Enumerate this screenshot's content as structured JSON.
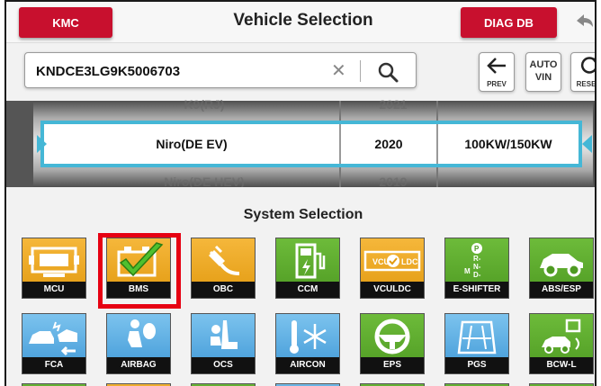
{
  "header": {
    "kmc_label": "KMC",
    "title": "Vehicle Selection",
    "diag_label": "DIAG DB"
  },
  "vin": {
    "value": "KNDCE3LG9K5006703",
    "clear_glyph": "✕"
  },
  "toolbar": {
    "prev_label": "PREV",
    "auto_vin_line1": "AUTO",
    "auto_vin_line2": "VIN",
    "reset_label": "RESET"
  },
  "drum": {
    "above": {
      "model": "K9(RJ)",
      "year": "2021"
    },
    "selected": {
      "model": "Niro(DE EV)",
      "year": "2020",
      "engine": "100KW/150KW"
    },
    "below": {
      "model": "Niro(DE HEV)",
      "year": "2019"
    }
  },
  "systems": {
    "title": "System Selection",
    "row1": [
      {
        "label": "MCU",
        "color": "orange",
        "icon": "mcu-icon"
      },
      {
        "label": "BMS",
        "color": "orange",
        "icon": "battery-check-icon",
        "selected": true
      },
      {
        "label": "OBC",
        "color": "orange",
        "icon": "charger-plug-icon"
      },
      {
        "label": "CCM",
        "color": "green",
        "icon": "charging-station-icon"
      },
      {
        "label": "VCULDC",
        "color": "orange",
        "icon": "vcu-ldc-icon",
        "art_text": [
          "VCU",
          "LDC"
        ]
      },
      {
        "label": "E-SHIFTER",
        "color": "green",
        "icon": "gear-shifter-icon",
        "art_text": [
          "P",
          "R-",
          "N-",
          "D-",
          "M"
        ]
      },
      {
        "label": "ABS/ESP",
        "color": "green",
        "icon": "car-side-icon"
      }
    ],
    "row2": [
      {
        "label": "FCA",
        "color": "blue",
        "icon": "collision-cars-icon"
      },
      {
        "label": "AIRBAG",
        "color": "blue",
        "icon": "airbag-icon"
      },
      {
        "label": "OCS",
        "color": "blue",
        "icon": "seat-occupant-icon"
      },
      {
        "label": "AIRCON",
        "color": "blue",
        "icon": "snowflake-thermo-icon"
      },
      {
        "label": "EPS",
        "color": "green",
        "icon": "steering-wheel-icon"
      },
      {
        "label": "PGS",
        "color": "blue",
        "icon": "parking-guide-icon"
      },
      {
        "label": "BCW-L",
        "color": "green",
        "icon": "blind-spot-icon"
      }
    ]
  },
  "colors": {
    "brand_red": "#c8102e",
    "selection_cyan": "#45b7d6",
    "highlight_red": "#e60012"
  }
}
